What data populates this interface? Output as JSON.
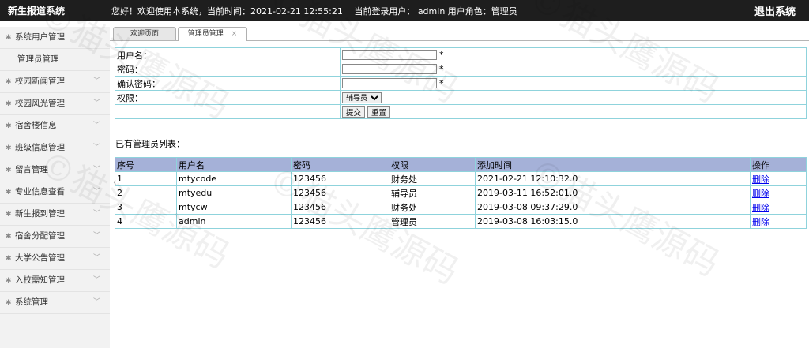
{
  "header": {
    "title": "新生报道系统",
    "welcome": "您好！欢迎使用本系统，当前时间：2021-02-21 12:55:21　 当前登录用户： admin  用户角色：管理员",
    "logout": "退出系统"
  },
  "sidebar": {
    "items": [
      {
        "label": "系统用户管理",
        "sub": [
          {
            "label": "管理员管理"
          }
        ]
      },
      {
        "label": "校园新闻管理"
      },
      {
        "label": "校园风光管理"
      },
      {
        "label": "宿舍楼信息"
      },
      {
        "label": "班级信息管理"
      },
      {
        "label": "留言管理"
      },
      {
        "label": "专业信息查看"
      },
      {
        "label": "新生报到管理"
      },
      {
        "label": "宿舍分配管理"
      },
      {
        "label": "大学公告管理"
      },
      {
        "label": "入校需知管理"
      },
      {
        "label": "系统管理"
      }
    ]
  },
  "tabs": [
    {
      "label": "欢迎页面"
    },
    {
      "label": "管理员管理",
      "close": "×"
    }
  ],
  "form": {
    "username_label": "用户名：",
    "password_label": "密码：",
    "confirm_label": "确认密码：",
    "role_label": "权限：",
    "required_mark": "*",
    "username_value": "",
    "password_value": "",
    "confirm_value": "",
    "role_selected": "辅导员",
    "submit_label": "提交",
    "reset_label": "重置"
  },
  "list": {
    "title": "已有管理员列表：",
    "headers": [
      "序号",
      "用户名",
      "密码",
      "权限",
      "添加时间",
      "操作"
    ],
    "rows": [
      {
        "id": "1",
        "username": "mtycode",
        "password": "123456",
        "role": "财务处",
        "added": "2021-02-21 12:10:32.0",
        "action": "删除"
      },
      {
        "id": "2",
        "username": "mtyedu",
        "password": "123456",
        "role": "辅导员",
        "added": "2019-03-11 16:52:01.0",
        "action": "删除"
      },
      {
        "id": "3",
        "username": "mtycw",
        "password": "123456",
        "role": "财务处",
        "added": "2019-03-08 09:37:29.0",
        "action": "删除"
      },
      {
        "id": "4",
        "username": "admin",
        "password": "123456",
        "role": "管理员",
        "added": "2019-03-08 16:03:15.0",
        "action": "删除"
      }
    ]
  },
  "watermark": "©猫头鹰源码"
}
